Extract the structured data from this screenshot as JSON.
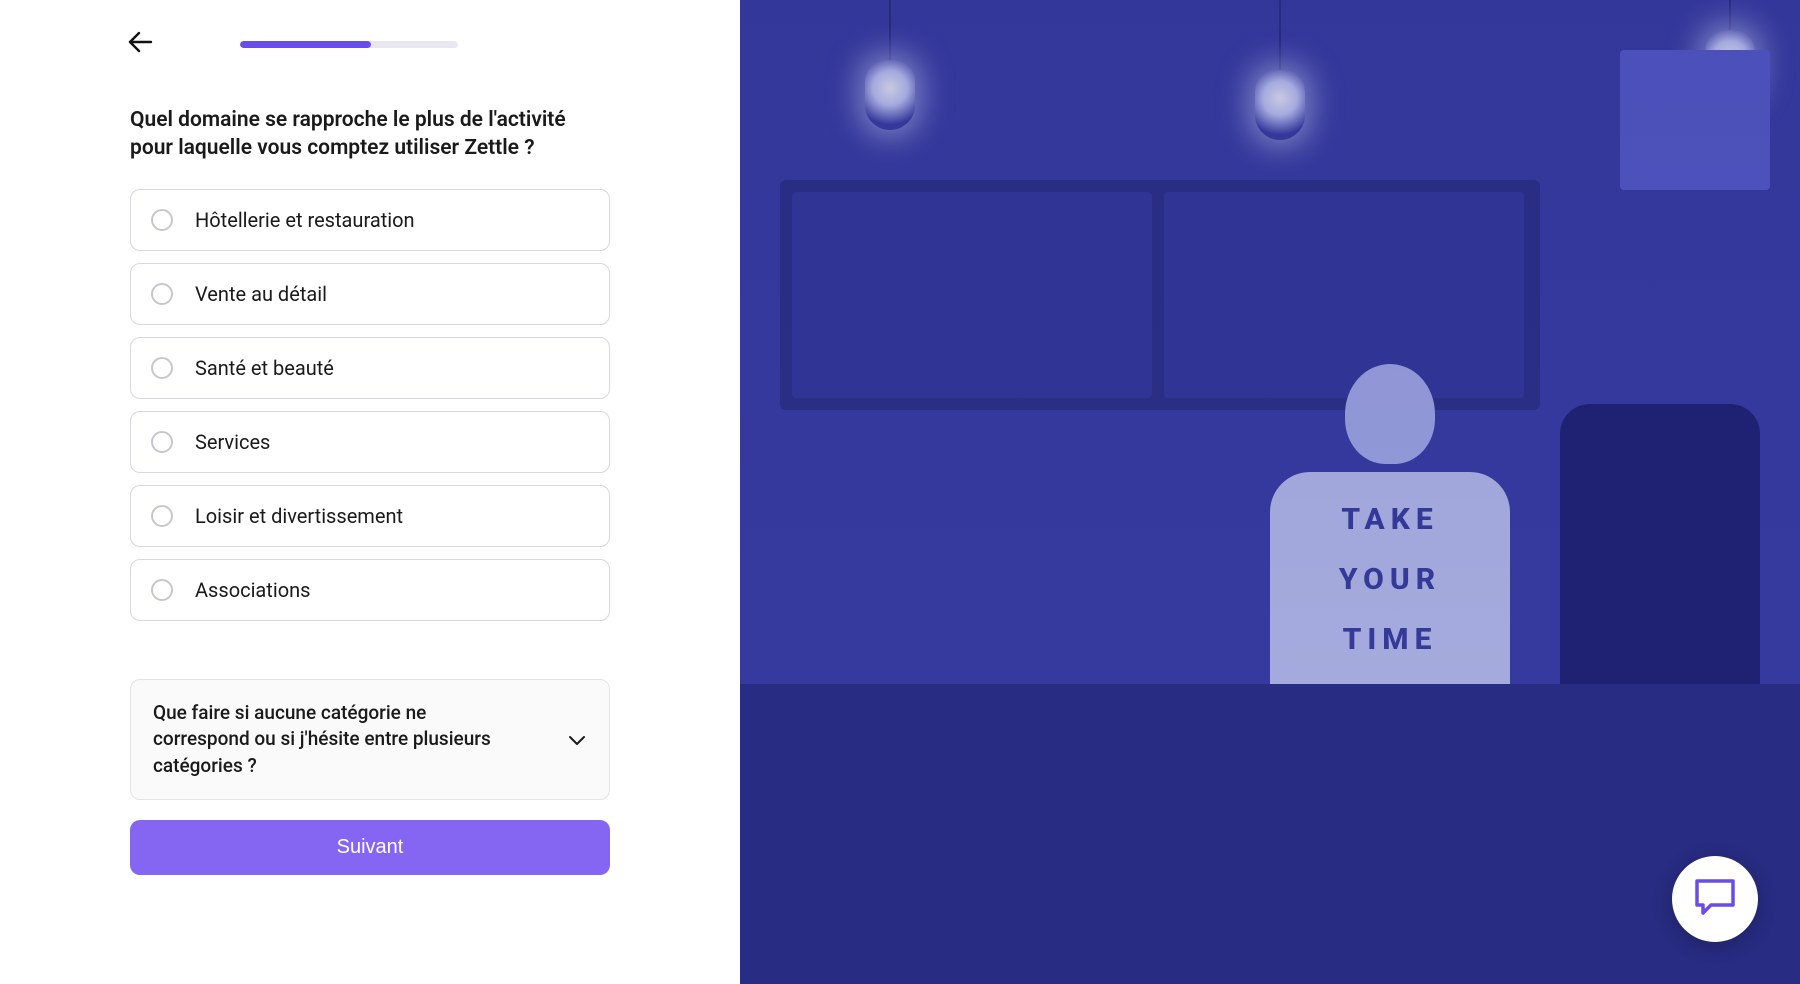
{
  "progress": {
    "percent": 60
  },
  "question": "Quel domaine se rapproche le plus de l'activité pour laquelle vous comptez utiliser Zettle ?",
  "options": [
    {
      "label": "Hôtellerie et restauration"
    },
    {
      "label": "Vente au détail"
    },
    {
      "label": "Santé et beauté"
    },
    {
      "label": "Services"
    },
    {
      "label": "Loisir et divertissement"
    },
    {
      "label": "Associations"
    }
  ],
  "help": {
    "text": "Que faire si aucune catégorie ne correspond ou si j'hésite entre plusieurs catégories ?"
  },
  "next_label": "Suivant",
  "shirt": {
    "l1": "TAKE",
    "l2": "YOUR",
    "l3": "TIME"
  },
  "colors": {
    "accent": "#6a4de8",
    "accent_light": "#8466f3"
  }
}
